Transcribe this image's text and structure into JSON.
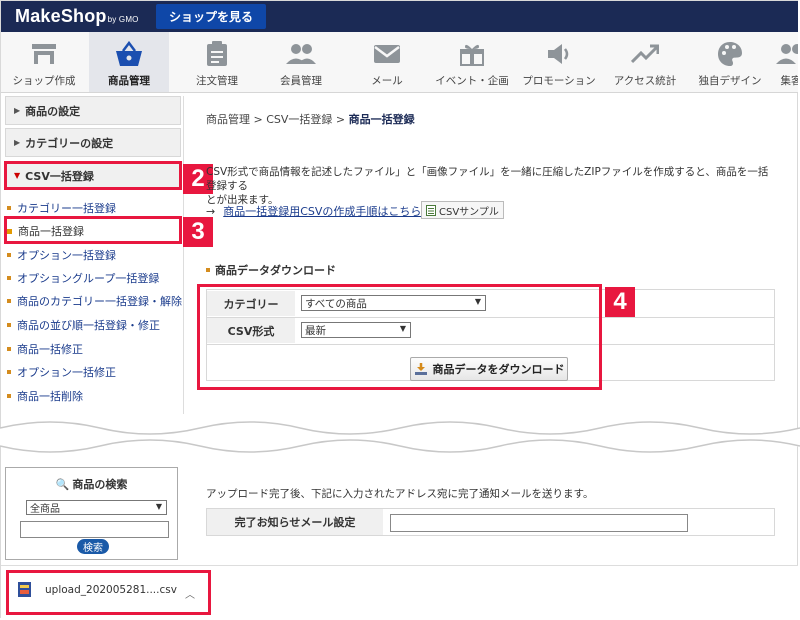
{
  "header": {
    "logo": "MakeShop",
    "logo_suffix": "by GMO",
    "shop_button": "ショップを見る"
  },
  "nav": {
    "items": [
      {
        "label": "ショップ作成",
        "icon": "shop-icon"
      },
      {
        "label": "商品管理",
        "icon": "basket-icon",
        "active": true
      },
      {
        "label": "注文管理",
        "icon": "clipboard-icon"
      },
      {
        "label": "会員管理",
        "icon": "users-icon"
      },
      {
        "label": "メール",
        "icon": "mail-icon"
      },
      {
        "label": "イベント・企画",
        "icon": "gift-icon"
      },
      {
        "label": "プロモーション",
        "icon": "speaker-icon"
      },
      {
        "label": "アクセス統計",
        "icon": "trend-icon"
      },
      {
        "label": "独自デザイン",
        "icon": "palette-icon"
      },
      {
        "label": "集客",
        "icon": "users-icon"
      }
    ]
  },
  "sidebar": {
    "sections": [
      {
        "label": "商品の設定"
      },
      {
        "label": "カテゴリーの設定"
      },
      {
        "label": "CSV一括登録",
        "open": true
      }
    ],
    "links": [
      {
        "label": "カテゴリー一括登録"
      },
      {
        "label": "商品一括登録",
        "current": true
      },
      {
        "label": "オプション一括登録"
      },
      {
        "label": "オプショングループ一括登録"
      },
      {
        "label": "商品のカテゴリー一括登録・解除"
      },
      {
        "label": "商品の並び順一括登録・修正"
      },
      {
        "label": "商品一括修正"
      },
      {
        "label": "オプション一括修正"
      },
      {
        "label": "商品一括削除"
      }
    ]
  },
  "annotations": {
    "step2": "2",
    "step3": "3",
    "step4": "4"
  },
  "main": {
    "breadcrumb": {
      "part1": "商品管理",
      "part2": "CSV一括登録",
      "current": "商品一括登録",
      "sep": " > "
    },
    "description_line1": "CSV形式で商品情報を記述したファイル」と「画像ファイル」を一緒に圧縮したZIPファイルを作成すると、商品を一括登録する",
    "description_line2": "とが出来ます。",
    "guide_arrow": "→",
    "guide_link": "商品一括登録用CSVの作成手順はこちら",
    "csv_sample": "CSVサンプル",
    "download_section": {
      "title": "商品データダウンロード",
      "category_label": "カテゴリー",
      "category_value": "すべての商品",
      "csv_label": "CSV形式",
      "csv_value": "最新",
      "button": "商品データをダウンロード"
    },
    "notice": "アップロード完了後、下記に入力されたアドレス宛に完了通知メールを送ります。",
    "mail_label": "完了お知らせメール設定",
    "mail_value": ""
  },
  "search": {
    "title": "商品の検索",
    "select_value": "全商品",
    "input_value": "",
    "button": "検索"
  },
  "download_bar": {
    "filename": "upload_202005281....csv"
  }
}
